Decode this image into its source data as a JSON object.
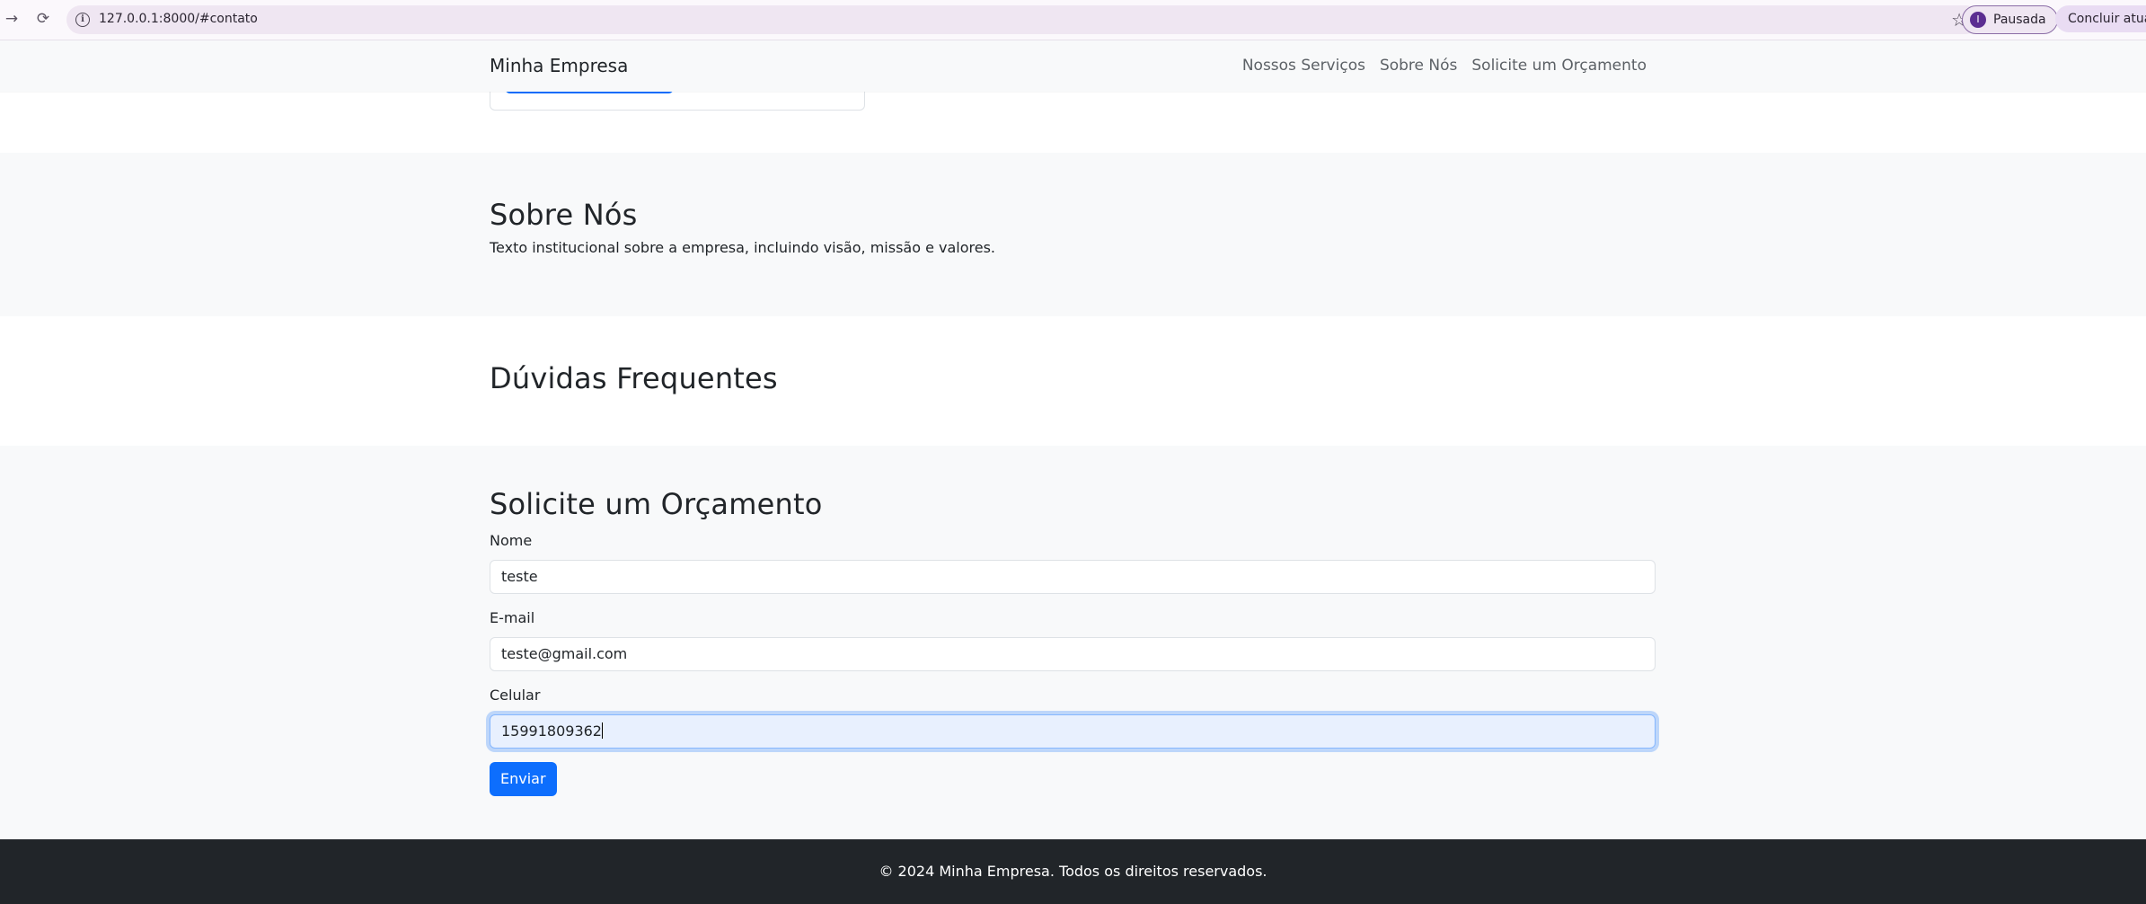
{
  "browser": {
    "url": "127.0.0.1:8000/#contato",
    "profile_label": "Pausada",
    "profile_initial": "I",
    "update_label": "Concluir atualiza"
  },
  "navbar": {
    "brand": "Minha Empresa",
    "links": [
      "Nossos Serviços",
      "Sobre Nós",
      "Solicite um Orçamento"
    ]
  },
  "about": {
    "title": "Sobre Nós",
    "text": "Texto institucional sobre a empresa, incluindo visão, missão e valores."
  },
  "faq": {
    "title": "Dúvidas Frequentes"
  },
  "contact": {
    "title": "Solicite um Orçamento",
    "name_label": "Nome",
    "name_value": "teste",
    "email_label": "E-mail",
    "email_value": "teste@gmail.com",
    "phone_label": "Celular",
    "phone_value": "15991809362",
    "submit_label": "Enviar"
  },
  "footer": {
    "text": "© 2024 Minha Empresa. Todos os direitos reservados."
  },
  "colors": {
    "primary": "#0d6efd",
    "footer_bg": "#212529",
    "section_bg": "#f8f9fa"
  }
}
